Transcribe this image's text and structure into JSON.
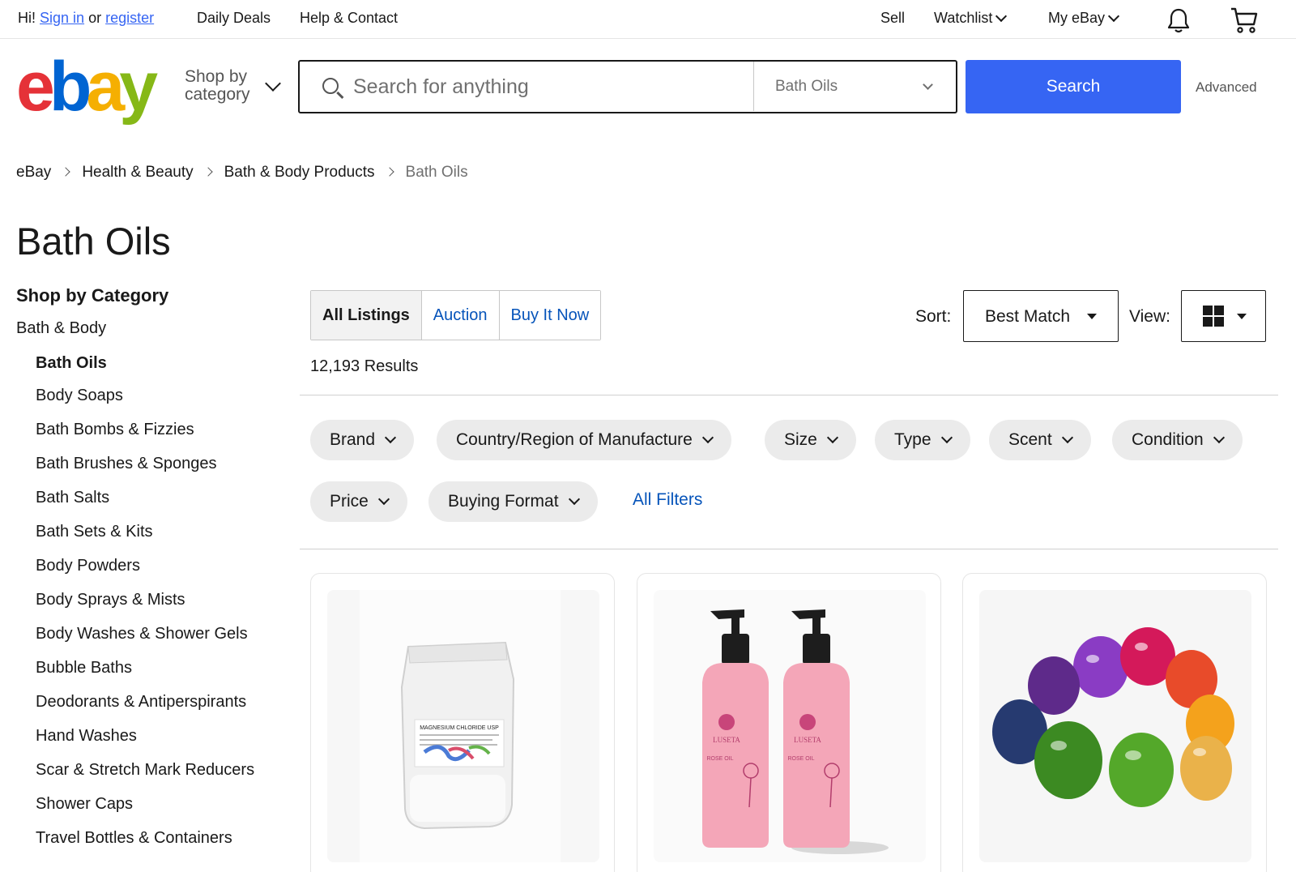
{
  "topbar": {
    "greeting": "Hi!",
    "sign_in": "Sign in",
    "or": "or",
    "register": "register",
    "daily_deals": "Daily Deals",
    "help_contact": "Help & Contact",
    "sell": "Sell",
    "watchlist": "Watchlist",
    "my_ebay": "My eBay"
  },
  "header": {
    "logo_letters": [
      "e",
      "b",
      "a",
      "y"
    ],
    "logo_colors": [
      "#e53238",
      "#0064d2",
      "#f5af02",
      "#86b817"
    ],
    "shop_by_line1": "Shop by",
    "shop_by_line2": "category",
    "search_placeholder": "Search for anything",
    "category_value": "Bath Oils",
    "search_button": "Search",
    "advanced": "Advanced"
  },
  "breadcrumb": [
    "eBay",
    "Health & Beauty",
    "Bath & Body Products",
    "Bath Oils"
  ],
  "page_title": "Bath Oils",
  "sidebar": {
    "heading": "Shop by Category",
    "parent": "Bath & Body",
    "categories": [
      "Bath Oils",
      "Body Soaps",
      "Bath Bombs & Fizzies",
      "Bath Brushes & Sponges",
      "Bath Salts",
      "Bath Sets & Kits",
      "Body Powders",
      "Body Sprays & Mists",
      "Body Washes & Shower Gels",
      "Bubble Baths",
      "Deodorants & Antiperspirants",
      "Hand Washes",
      "Scar & Stretch Mark Reducers",
      "Shower Caps",
      "Travel Bottles & Containers"
    ]
  },
  "tabs": [
    "All Listings",
    "Auction",
    "Buy It Now"
  ],
  "results_count": "12,193 Results",
  "sort": {
    "label": "Sort:",
    "value": "Best Match"
  },
  "view": {
    "label": "View:"
  },
  "filters_row1": [
    "Brand",
    "Country/Region of Manufacture",
    "Size",
    "Type",
    "Scent",
    "Condition"
  ],
  "filters_row2": [
    "Price",
    "Buying Format"
  ],
  "all_filters": "All Filters",
  "products": [
    {
      "label_line1": "MAGNESIUM CHLORIDE USP"
    },
    {
      "brand": "LUSETA",
      "label_line1": "ROSE OIL"
    },
    {
      "description": "bath oil beads"
    }
  ],
  "colors": {
    "accent": "#3665f3",
    "link": "#0654ba"
  }
}
